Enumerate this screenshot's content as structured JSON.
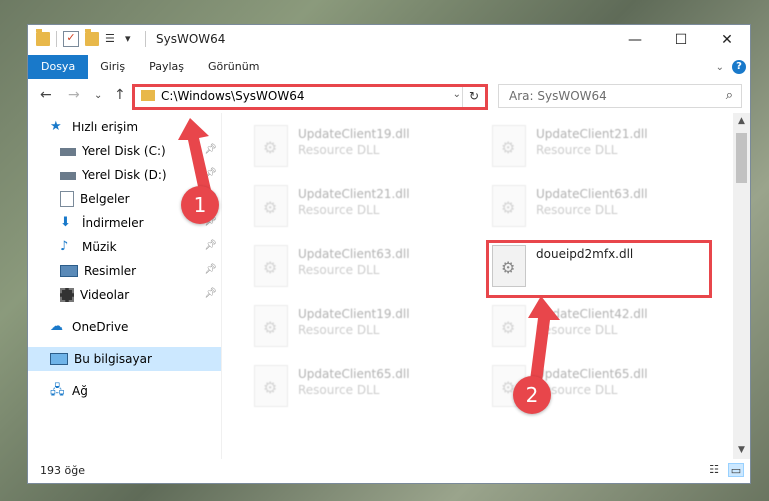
{
  "window": {
    "title": "SysWOW64",
    "buttons": {
      "minimize": "—",
      "maximize": "☐",
      "close": "✕"
    }
  },
  "ribbon": {
    "tabs": [
      {
        "label": "Dosya",
        "active": true
      },
      {
        "label": "Giriş"
      },
      {
        "label": "Paylaş"
      },
      {
        "label": "Görünüm"
      }
    ]
  },
  "address": {
    "path": "C:\\Windows\\SysWOW64"
  },
  "search": {
    "placeholder": "Ara: SysWOW64"
  },
  "sidebar": {
    "items": [
      {
        "label": "Hızlı erişim",
        "icon": "star-icon"
      },
      {
        "label": "Yerel Disk (C:)",
        "icon": "drive-icon",
        "pinned": true
      },
      {
        "label": "Yerel Disk (D:)",
        "icon": "drive-icon",
        "pinned": true
      },
      {
        "label": "Belgeler",
        "icon": "documents-icon",
        "pinned": true
      },
      {
        "label": "İndirmeler",
        "icon": "downloads-icon",
        "pinned": true
      },
      {
        "label": "Müzik",
        "icon": "music-icon",
        "pinned": true
      },
      {
        "label": "Resimler",
        "icon": "pictures-icon",
        "pinned": true
      },
      {
        "label": "Videolar",
        "icon": "videos-icon",
        "pinned": true
      },
      {
        "label": "OneDrive",
        "icon": "cloud-icon"
      },
      {
        "label": "Bu bilgisayar",
        "icon": "computer-icon",
        "selected": true
      },
      {
        "label": "Ağ",
        "icon": "network-icon"
      }
    ]
  },
  "files": [
    {
      "name": "UpdateClient19.dll",
      "type": "Resource DLL"
    },
    {
      "name": "UpdateClient21.dll",
      "type": "Resource DLL"
    },
    {
      "name": "UpdateClient21.dll",
      "type": "Resource DLL"
    },
    {
      "name": "UpdateClient63.dll",
      "type": "Resource DLL"
    },
    {
      "name": "UpdateClient63.dll",
      "type": "Resource DLL"
    },
    {
      "name": "doueipd2mfx.dll",
      "type": ""
    },
    {
      "name": "UpdateClient19.dll",
      "type": "Resource DLL"
    },
    {
      "name": "UpdateClient42.dll",
      "type": "Resource DLL"
    },
    {
      "name": "UpdateClient65.dll",
      "type": "Resource DLL"
    },
    {
      "name": "UpdateClient65.dll",
      "type": "Resource DLL"
    }
  ],
  "status": {
    "count": "193 öğe"
  },
  "annotations": {
    "badge1": "1",
    "badge2": "2",
    "color": "#e8464b"
  }
}
